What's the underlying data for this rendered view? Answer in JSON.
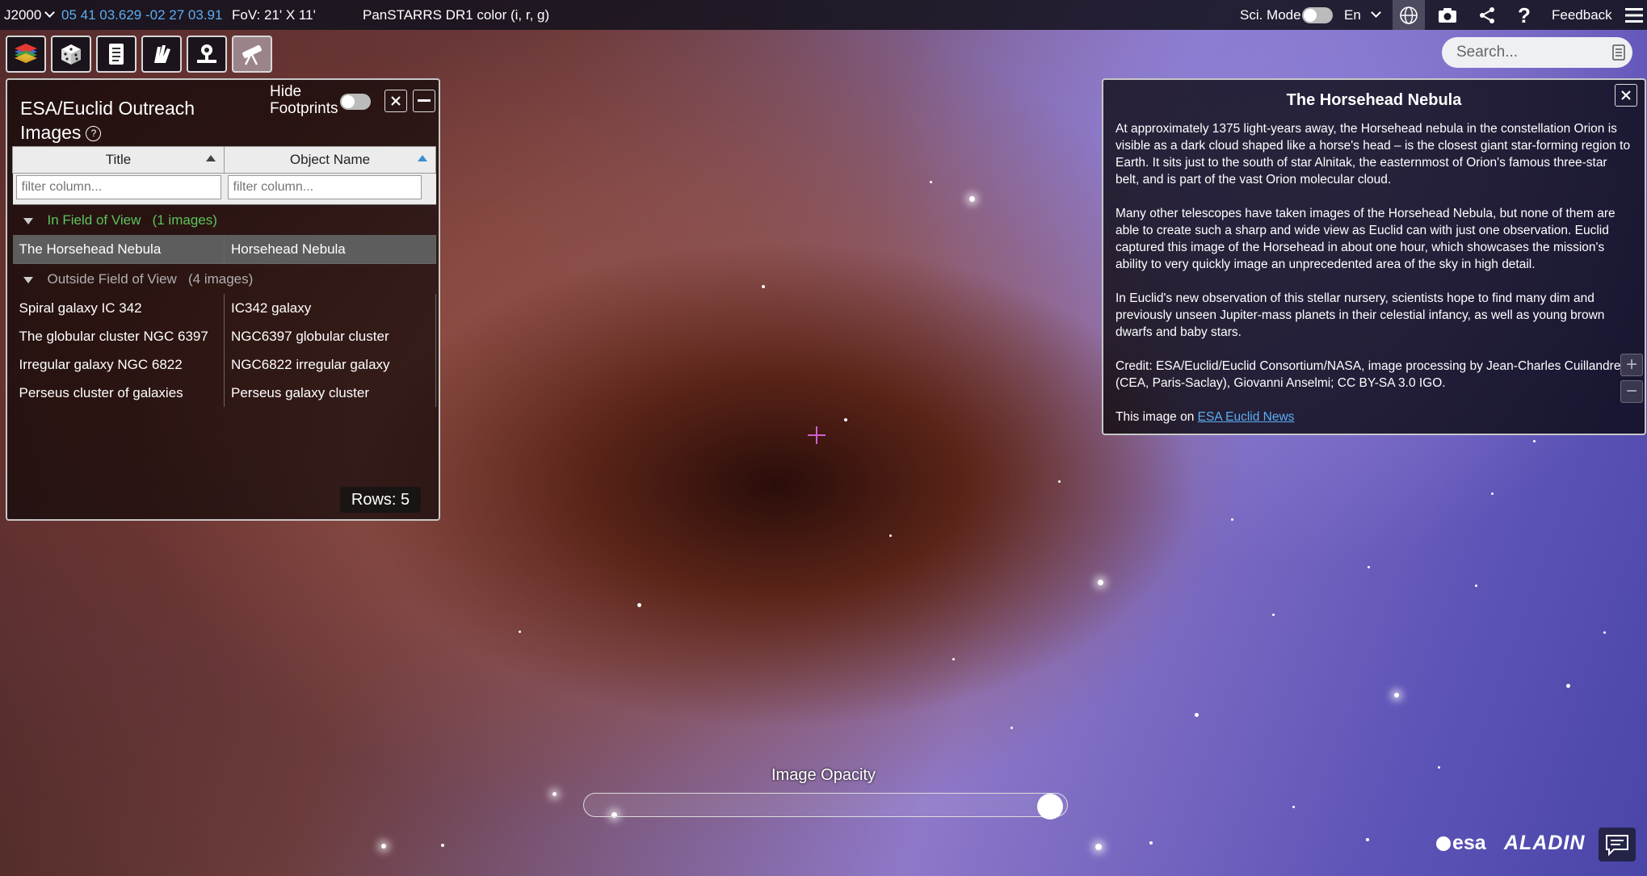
{
  "topbar": {
    "frame": "J2000",
    "coords": "05 41 03.629 -02 27 03.91",
    "fov": "FoV: 21' X 11'",
    "survey": "PanSTARRS DR1 color (i, r, g)",
    "sci_mode_label": "Sci. Mode",
    "language": "En",
    "feedback": "Feedback"
  },
  "toolbar": {
    "buttons": [
      "layers-icon",
      "cube-icon",
      "scroll-icon",
      "hand-icon",
      "radar-icon",
      "telescope-icon"
    ],
    "active": "telescope-icon"
  },
  "search": {
    "placeholder": "Search..."
  },
  "panel": {
    "title": "ESA/Euclid Outreach Images",
    "hide_footprints": "Hide Footprints",
    "columns": [
      "Title",
      "Object Name"
    ],
    "filter_placeholder": "filter column...",
    "groups": [
      {
        "label": "In Field of View",
        "count": "(1 images)",
        "color": "#5cc35c",
        "rows": [
          [
            "The Horsehead Nebula",
            "Horsehead Nebula"
          ]
        ]
      },
      {
        "label": "Outside Field of View",
        "count": "(4 images)",
        "color": "#b0b0b0",
        "rows": [
          [
            "Spiral galaxy IC 342",
            "IC342 galaxy"
          ],
          [
            "The globular cluster NGC 6397",
            "NGC6397 globular cluster"
          ],
          [
            "Irregular galaxy NGC 6822",
            "NGC6822 irregular galaxy"
          ],
          [
            "Perseus cluster of galaxies",
            "Perseus galaxy cluster"
          ]
        ]
      }
    ],
    "rows_label": "Rows: 5"
  },
  "info": {
    "title": "The Horsehead Nebula",
    "p1": "At approximately 1375 light-years away, the Horsehead nebula in the constellation Orion is visible as a dark cloud shaped like a horse's head – is the closest giant star-forming region to Earth. It sits just to the south of star Alnitak, the easternmost of Orion's famous three-star belt, and is part of the vast Orion molecular cloud.",
    "p2": "Many other telescopes have taken images of the Horsehead Nebula, but none of them are able to create such a sharp and wide view as Euclid can with just one observation. Euclid captured this image of the Horsehead in about one hour, which showcases the mission's ability to very quickly image an unprecedented area of the sky in high detail.",
    "p3": "In Euclid's new observation of this stellar nursery, scientists hope to find many dim and previously unseen Jupiter-mass planets in their celestial infancy, as well as young brown dwarfs and baby stars.",
    "p4": "Credit: ESA/Euclid/Euclid Consortium/NASA, image processing by Jean-Charles Cuillandre (CEA, Paris-Saclay), Giovanni Anselmi; CC BY-SA 3.0 IGO.",
    "link_prefix": "This image on ",
    "link_text": "ESA Euclid News"
  },
  "opacity": {
    "label": "Image Opacity",
    "value": 1.0
  },
  "logos": {
    "esa": "esa",
    "aladin": "ALADIN"
  },
  "colors": {
    "coords": "#5aaef2",
    "link": "#5aaef2"
  }
}
